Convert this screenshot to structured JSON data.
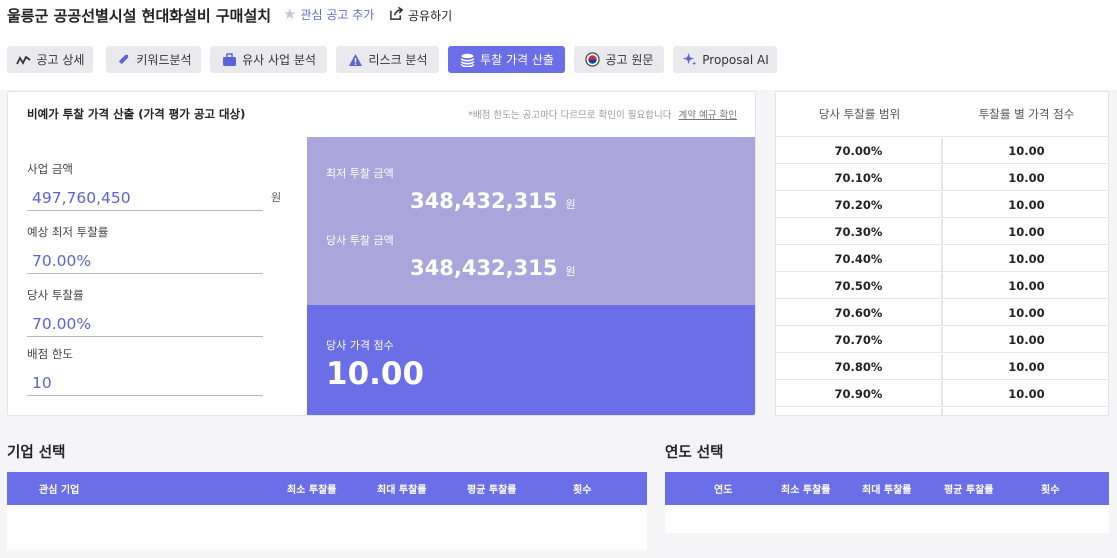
{
  "header": {
    "title": "울릉군 공공선별시설 현대화설비 구매설치",
    "favorite_label": "관심 공고 추가",
    "share_label": "공유하기"
  },
  "tabs": [
    {
      "label": "공고 상세",
      "icon": "chart-line-icon"
    },
    {
      "label": "키워드분석",
      "icon": "tag-icon"
    },
    {
      "label": "유사 사업 분석",
      "icon": "briefcase-icon"
    },
    {
      "label": "리스크 분석",
      "icon": "warning-icon"
    },
    {
      "label": "투찰 가격 산출",
      "icon": "coins-icon",
      "active": true
    },
    {
      "label": "공고 원문",
      "icon": "korea-flag-icon"
    },
    {
      "label": "Proposal AI",
      "icon": "sparkle-icon"
    }
  ],
  "calc": {
    "title": "비예가 투찰 가격 산출 (가격 평가 공고 대상)",
    "note": "*배점 한도는 공고마다 다르므로 확인이 필요합니다",
    "note_link": "계약 예규 확인",
    "business_amount_label": "사업 금액",
    "business_amount_value": "497,760,450",
    "unit_won": "원",
    "expected_min_rate_label": "예상 최저 투찰률",
    "expected_min_rate_value": "70.00%",
    "our_rate_label": "당사 투찰률",
    "our_rate_value": "70.00%",
    "score_limit_label": "배점 한도",
    "score_limit_value": "10",
    "min_bid_label": "최저 투찰 금액",
    "min_bid_value": "348,432,315",
    "our_bid_label": "당사 투찰 금액",
    "our_bid_value": "348,432,315",
    "our_score_label": "당사 가격 점수",
    "our_score_value": "10.00"
  },
  "rate_table": {
    "headers": [
      "당사 투찰률 범위",
      "투찰률 별 가격 점수"
    ],
    "rows": [
      [
        "70.00%",
        "10.00"
      ],
      [
        "70.10%",
        "10.00"
      ],
      [
        "70.20%",
        "10.00"
      ],
      [
        "70.30%",
        "10.00"
      ],
      [
        "70.40%",
        "10.00"
      ],
      [
        "70.50%",
        "10.00"
      ],
      [
        "70.60%",
        "10.00"
      ],
      [
        "70.70%",
        "10.00"
      ],
      [
        "70.80%",
        "10.00"
      ],
      [
        "70.90%",
        "10.00"
      ]
    ]
  },
  "company_section": {
    "title": "기업 선택",
    "headers": [
      "관심 기업",
      "최소 투찰률",
      "최대 투찰률",
      "평균 투찰률",
      "횟수"
    ]
  },
  "year_section": {
    "title": "연도 선택",
    "headers": [
      "연도",
      "최소 투찰률",
      "최대 투찰률",
      "평균 투찰률",
      "횟수"
    ]
  },
  "colors": {
    "accent": "#6a6fe8",
    "accent_light": "#aaa6dc",
    "value_text": "#5b63d8"
  }
}
